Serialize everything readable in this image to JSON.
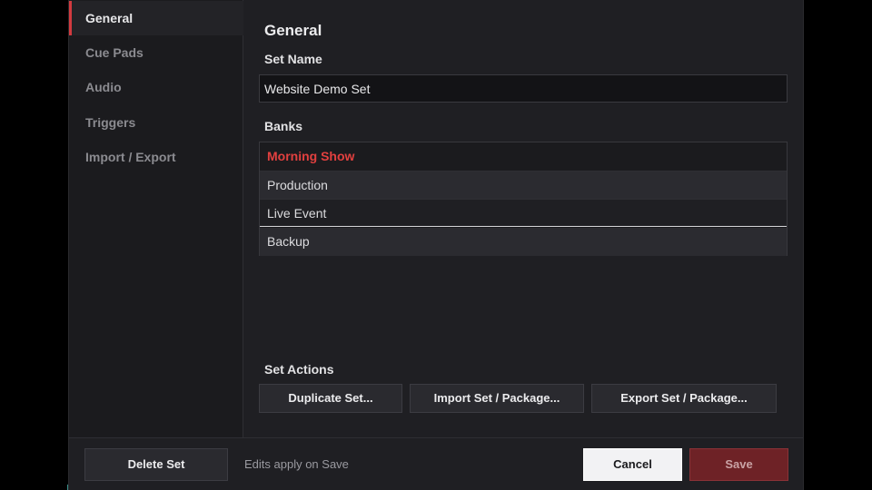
{
  "sidebar": {
    "items": [
      {
        "label": "General",
        "active": true
      },
      {
        "label": "Cue Pads",
        "active": false
      },
      {
        "label": "Audio",
        "active": false
      },
      {
        "label": "Triggers",
        "active": false
      },
      {
        "label": "Import / Export",
        "active": false
      }
    ]
  },
  "main": {
    "section_title": "General",
    "set_name_label": "Set Name",
    "set_name_value": "Website Demo Set",
    "banks_label": "Banks",
    "banks": [
      "Morning Show",
      "Production",
      "Live Event",
      "Backup"
    ],
    "selected_bank": "Morning Show",
    "set_actions_label": "Set Actions",
    "actions": {
      "duplicate": "Duplicate Set...",
      "import": "Import Set / Package...",
      "export": "Export Set / Package..."
    }
  },
  "footer": {
    "delete_label": "Delete Set",
    "note": "Edits apply on Save",
    "cancel_label": "Cancel",
    "save_label": "Save"
  },
  "colors": {
    "accent_red": "#d33a3f",
    "selected_bank_text": "#e2403f",
    "save_button_bg": "#6e2226",
    "panel_bg": "#1f1f23"
  }
}
